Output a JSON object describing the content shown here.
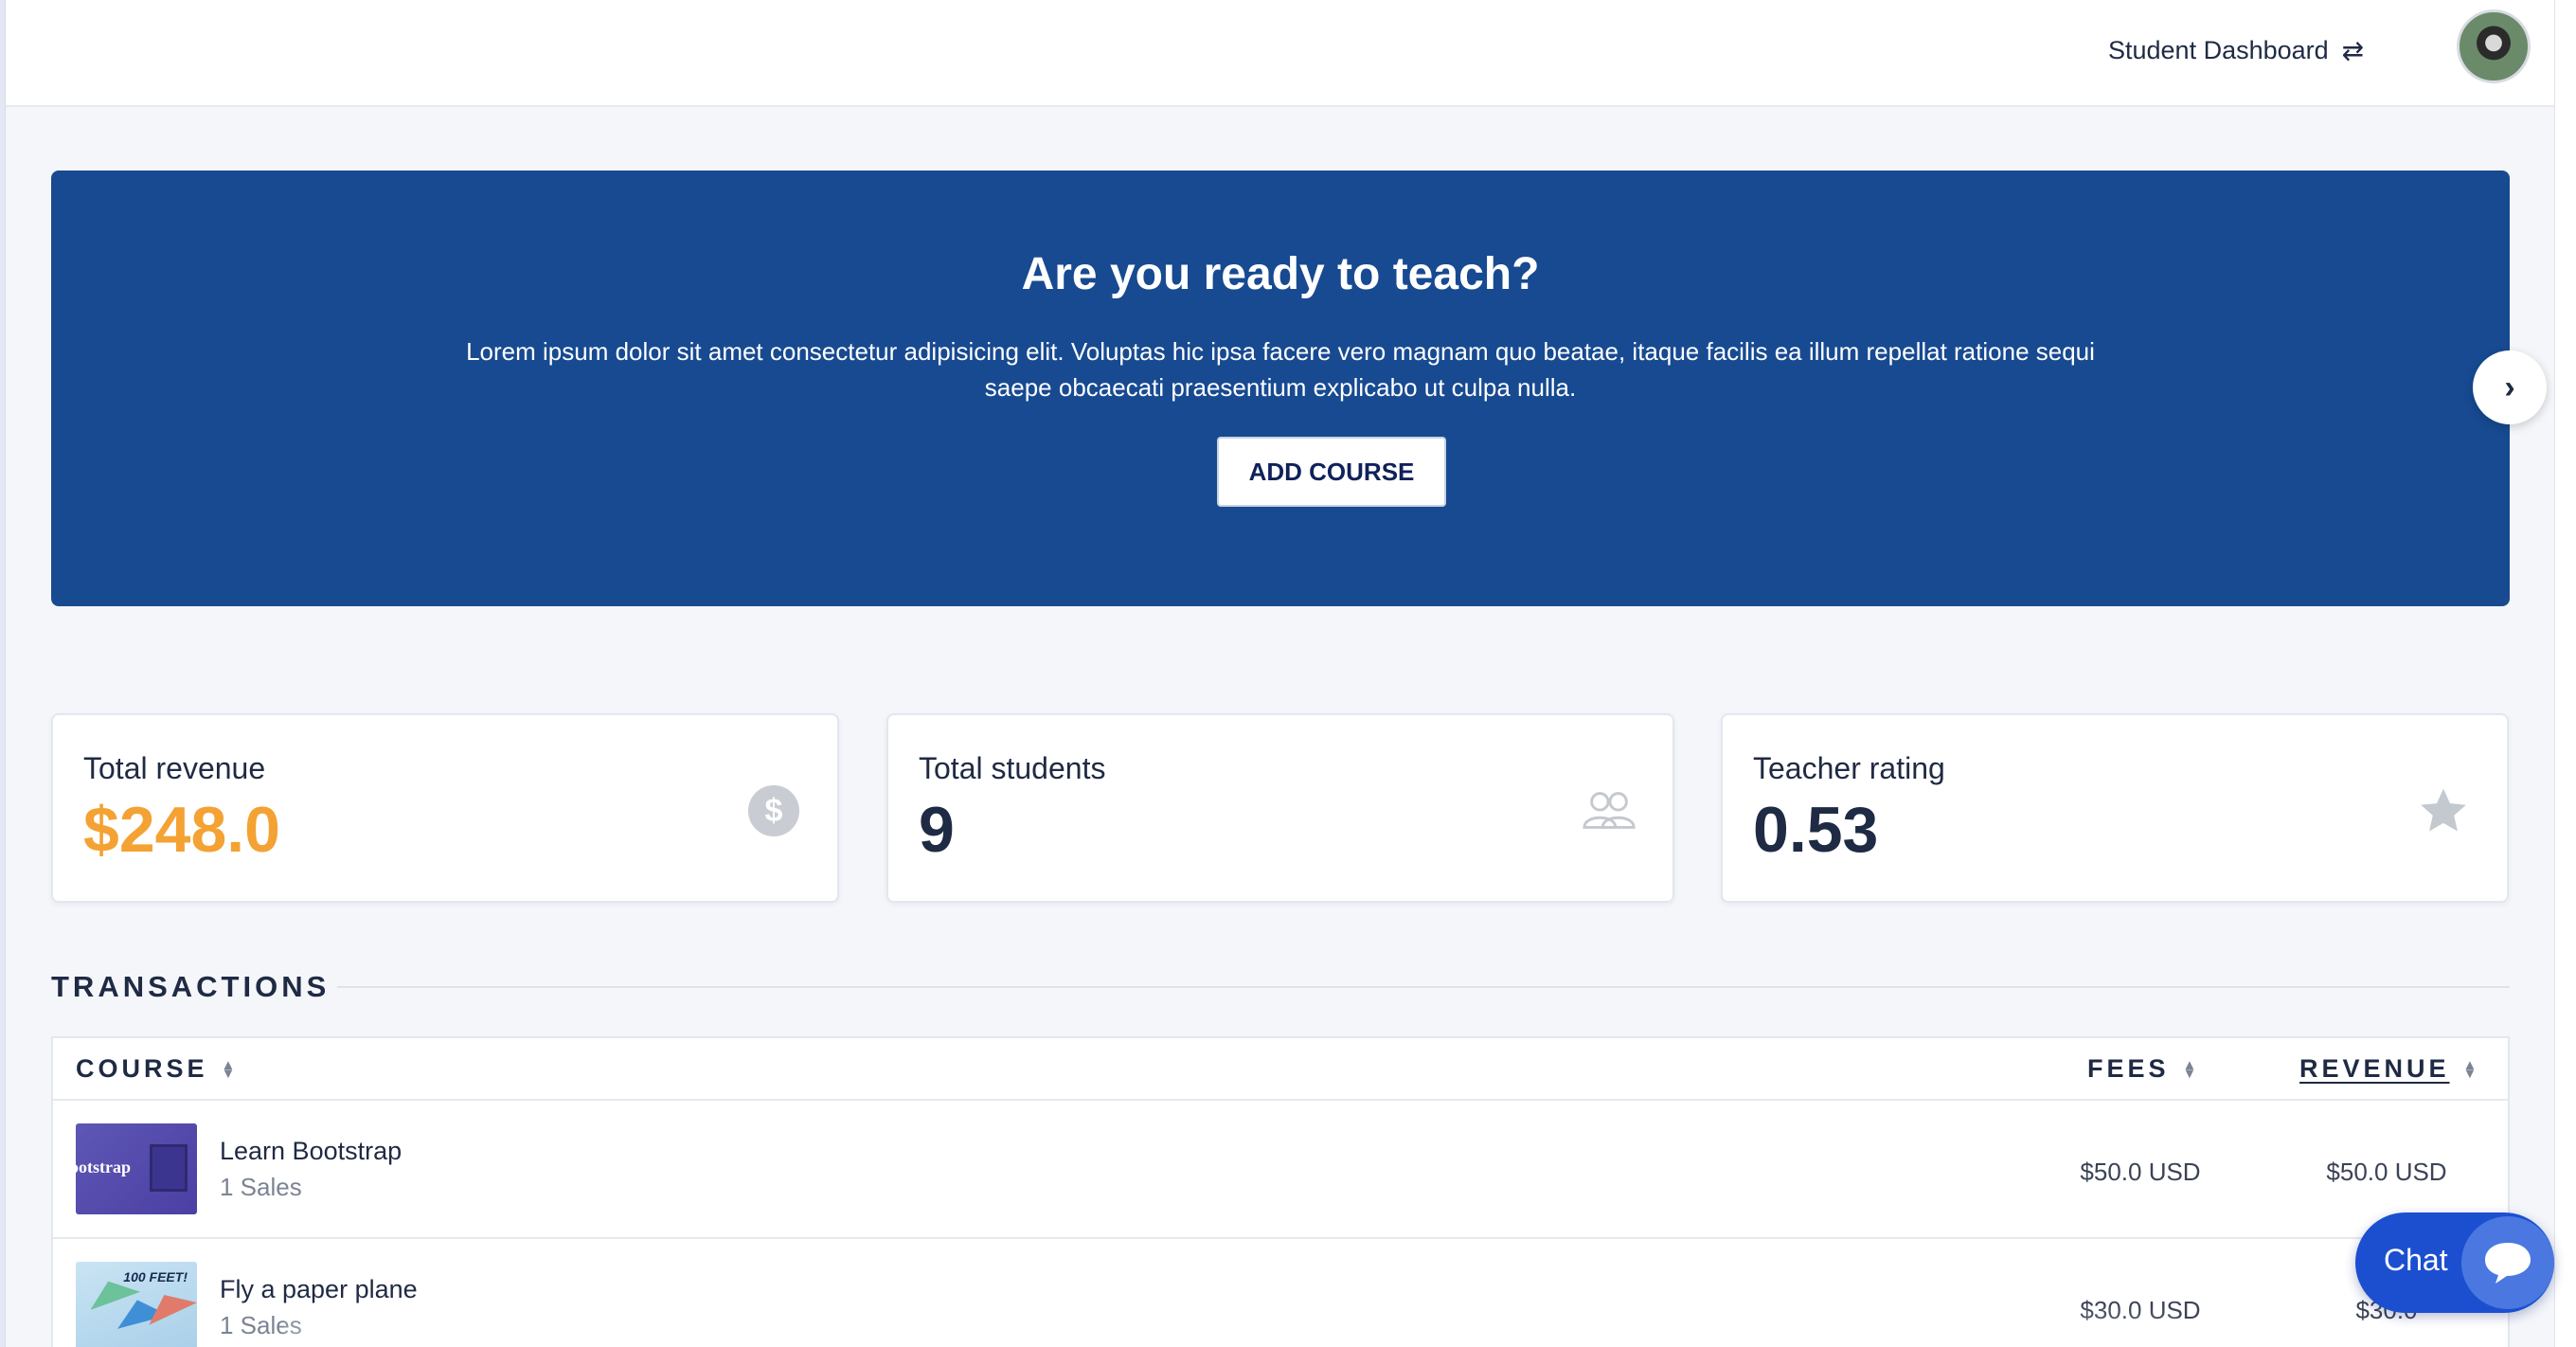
{
  "header": {
    "switch_label": "Student Dashboard",
    "switch_icon": "swap-arrows-icon",
    "avatar": "user-avatar"
  },
  "hero": {
    "title": "Are you ready to teach?",
    "text": "Lorem ipsum dolor sit amet consectetur adipisicing elit. Voluptas hic ipsa facere vero magnam quo beatae, itaque facilis ea illum repellat ratione sequi saepe obcaecati praesentium explicabo ut culpa nulla.",
    "button_label": "ADD COURSE",
    "next_icon": "chevron-right-icon"
  },
  "stats": [
    {
      "label": "Total revenue",
      "value": "$248.0",
      "icon": "dollar-circle-icon",
      "color": "#f4a233"
    },
    {
      "label": "Total students",
      "value": "9",
      "icon": "users-icon"
    },
    {
      "label": "Teacher rating",
      "value": "0.53",
      "icon": "star-icon"
    }
  ],
  "transactions": {
    "title": "TRANSACTIONS",
    "columns": [
      "COURSE",
      "FEES",
      "REVENUE"
    ],
    "rows": [
      {
        "course": "Learn Bootstrap",
        "thumb_text": "ootstrap",
        "sales": "1 Sales",
        "fees": "$50.0 USD",
        "revenue": "$50.0 USD"
      },
      {
        "course": "Fly a paper plane",
        "thumb_text": "100 FEET!",
        "sales": "1 Sales",
        "fees": "$30.0 USD",
        "revenue": "$30.0"
      }
    ]
  },
  "chat": {
    "label": "Chat",
    "icon": "chat-bubble-icon"
  },
  "colors": {
    "hero_bg": "#174a91",
    "accent": "#f4a233",
    "chat": "#1c4fd0"
  }
}
